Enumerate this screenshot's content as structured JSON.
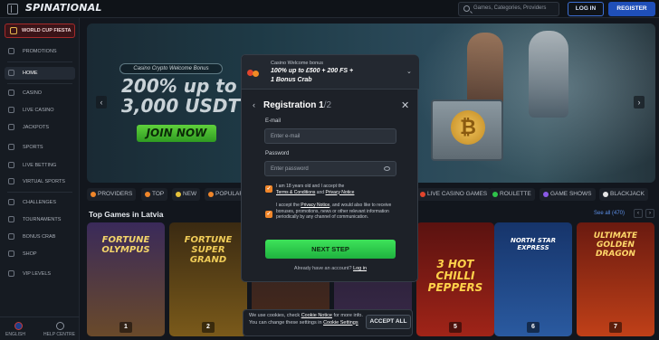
{
  "header": {
    "logo_text": "SPINATIONAL",
    "search_placeholder": "Games, Categories, Providers",
    "login_label": "LOG IN",
    "register_label": "REGISTER"
  },
  "sidebar": {
    "promo_label": "WORLD CUP FIESTA",
    "items": [
      {
        "label": "PROMOTIONS",
        "icon": "gift-icon"
      },
      {
        "label": "HOME",
        "icon": "home-icon"
      },
      {
        "label": "CASINO",
        "icon": "casino-icon"
      },
      {
        "label": "LIVE CASINO",
        "icon": "live-casino-icon"
      },
      {
        "label": "JACKPOTS",
        "icon": "jackpot-icon"
      },
      {
        "label": "SPORTS",
        "icon": "sports-icon"
      },
      {
        "label": "LIVE BETTING",
        "icon": "live-betting-icon"
      },
      {
        "label": "VIRTUAL SPORTS",
        "icon": "virtual-sports-icon"
      },
      {
        "label": "CHALLENGES",
        "icon": "challenges-icon"
      },
      {
        "label": "TOURNAMENTS",
        "icon": "tournaments-icon"
      },
      {
        "label": "BONUS CRAB",
        "icon": "crab-icon"
      },
      {
        "label": "SHOP",
        "icon": "shop-icon"
      },
      {
        "label": "VIP LEVELS",
        "icon": "vip-icon"
      }
    ],
    "footer": {
      "language": "ENGLISH",
      "help": "HELP CENTRE"
    }
  },
  "hero": {
    "tag": "Casino Crypto Welcome Bonus",
    "title_line1": "200% up to",
    "title_line2": "3,000 USDT",
    "cta": "JOIN NOW"
  },
  "categories": [
    "PROVIDERS",
    "TOP",
    "NEW",
    "POPULAR",
    "LIVE CASINO GAMES",
    "ROULETTE",
    "GAME SHOWS",
    "BLACKJACK"
  ],
  "games_section": {
    "title": "Top Games in Latvia",
    "see_all": "See all (470)",
    "tiles": [
      {
        "title": "FORTUNE OLYMPUS",
        "rank": "1",
        "color": "#3a2a5a"
      },
      {
        "title": "FORTUNE SUPER GRAND",
        "rank": "2",
        "color": "#3a2a12"
      },
      {
        "title": "",
        "rank": "",
        "color": "#2a2024"
      },
      {
        "title": "",
        "rank": "",
        "color": "#241c30"
      },
      {
        "title": "3 HOT CHILLI PEPPERS",
        "rank": "5",
        "color": "#5a1210"
      },
      {
        "title": "NORTH STAR EXPRESS",
        "rank": "6",
        "color": "#16346a"
      },
      {
        "title": "ULTIMATE GOLDEN DRAGON",
        "rank": "7",
        "color": "#6a1a10"
      }
    ]
  },
  "modal": {
    "promo_heading": "Casino Welcome bonus",
    "promo_line1": "100% up to £500 + 200 FS +",
    "promo_line2": "1 Bonus Crab",
    "title": "Registration 1",
    "step_suffix": "/2",
    "email_label": "E-mail",
    "email_placeholder": "Enter e-mail",
    "password_label": "Password",
    "password_placeholder": "Enter password",
    "consent1_prefix": "I am 18 years old and I accept the",
    "consent1_terms": "Terms & Conditions",
    "consent1_and": "and",
    "consent1_privacy": "Privacy Notice",
    "consent2_prefix": "I accept the",
    "consent2_privacy": "Privacy Notice",
    "consent2_rest": ", and would also like to receive bonuses, promotions, news or other relevant information periodically by any channel of communication.",
    "next_label": "NEXT STEP",
    "already_text": "Already have an account?",
    "login_link": "Log in"
  },
  "cookie": {
    "text_prefix": "We use cookies, check",
    "notice_link": "Cookie Notice",
    "text_mid": "for more info. You can change these settings in",
    "settings_link": "Cookie Settings",
    "accept_label": "ACCEPT ALL"
  },
  "colors": {
    "accent_green": "#2fc24a",
    "accent_blue": "#1f4fb8",
    "promo_red": "#a52a2a",
    "checkbox_orange": "#f0862a"
  }
}
